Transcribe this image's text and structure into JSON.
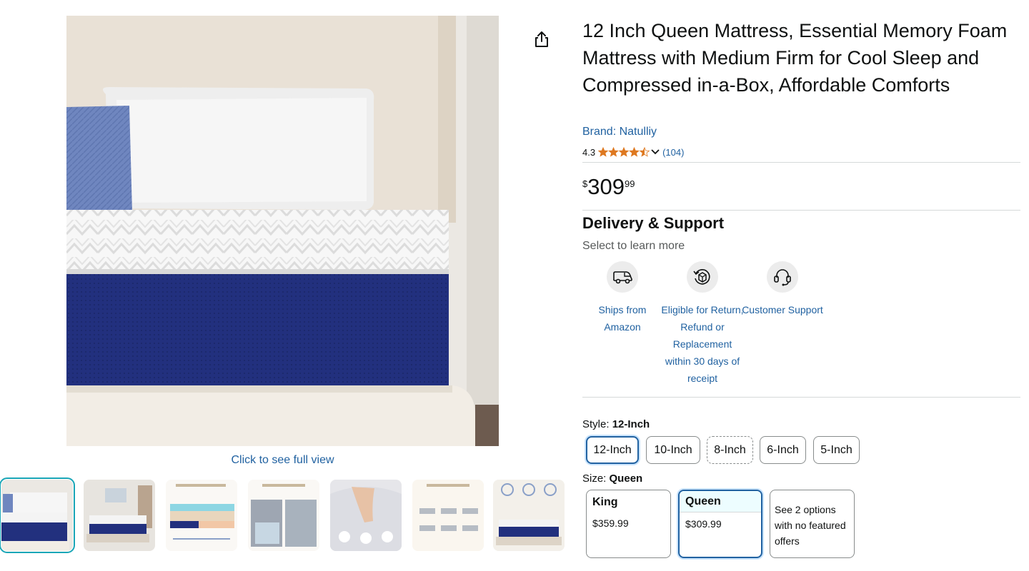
{
  "gallery": {
    "full_view_link": "Click to see full view",
    "thumbnails": [
      "thumb-1",
      "thumb-2",
      "thumb-3",
      "thumb-4",
      "thumb-5",
      "thumb-6",
      "thumb-7"
    ],
    "selected_index": 0
  },
  "product": {
    "title": "12 Inch Queen Mattress, Essential Memory Foam Mattress with Medium Firm for Cool Sleep and Compressed in-a-Box, Affordable Comforts",
    "brand": "Brand: Natulliy",
    "rating": {
      "score": "4.3",
      "stars": 4.5,
      "review_count": "(104)"
    },
    "price": {
      "symbol": "$",
      "whole": "309",
      "fraction": "99"
    }
  },
  "delivery": {
    "title": "Delivery & Support",
    "subtitle": "Select to learn more",
    "items": [
      {
        "icon": "delivery-van-icon",
        "label": "Ships from Amazon"
      },
      {
        "icon": "return-box-icon",
        "label": "Eligible for Return, Refund or Replacement within 30 days of receipt"
      },
      {
        "icon": "headset-icon",
        "label": "Customer Support"
      }
    ]
  },
  "style": {
    "label": "Style: ",
    "selected": "12-Inch",
    "options": [
      "12-Inch",
      "10-Inch",
      "8-Inch",
      "6-Inch",
      "5-Inch"
    ]
  },
  "size": {
    "label": "Size: ",
    "selected": "Queen",
    "options": [
      {
        "name": "King",
        "price": "$359.99"
      },
      {
        "name": "Queen",
        "price": "$309.99"
      }
    ],
    "more_note": "See 2 options with no featured offers"
  },
  "colors": {
    "link": "#2162a1",
    "star": "#de7921",
    "mattress_blue": "#1f2f7a",
    "selected_border": "#2162a1",
    "thumb_selected": "#1aa6b7"
  }
}
